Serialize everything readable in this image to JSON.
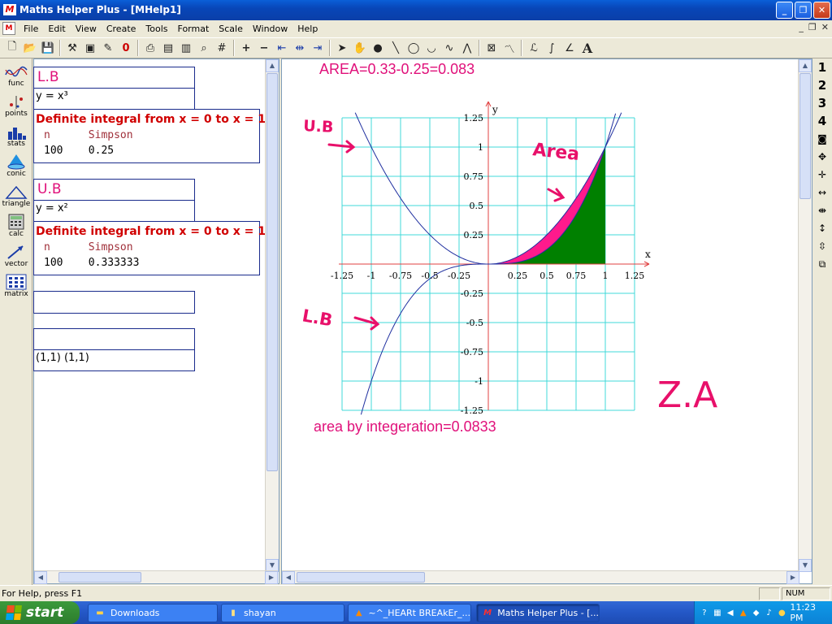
{
  "window": {
    "title": "Maths Helper Plus - [MHelp1]",
    "app_icon": "M",
    "buttons": [
      "minimize",
      "restore",
      "close"
    ]
  },
  "menu": {
    "items": [
      "File",
      "Edit",
      "View",
      "Create",
      "Tools",
      "Format",
      "Scale",
      "Window",
      "Help"
    ]
  },
  "toolbar": {
    "icons": [
      "new-icon",
      "open-icon",
      "save-icon",
      "tools-icon",
      "picture-icon",
      "pen-icon",
      "eraser-icon",
      "print-icon",
      "print-preview-icon",
      "print-setup-icon",
      "find-icon",
      "grid-icon",
      "zoom-in-icon",
      "zoom-out-icon",
      "fit-left-icon",
      "fit-center-icon",
      "fit-right-icon",
      "select-arrow-icon",
      "hand-icon",
      "point-icon",
      "line-icon",
      "ellipse-icon",
      "curve-icon",
      "wave-icon",
      "peak-icon",
      "clear-icon",
      "sketch-icon",
      "text-style-icon",
      "integral-icon",
      "angle-icon",
      "text-icon"
    ],
    "text_label": "A"
  },
  "left_toolbar": {
    "items": [
      {
        "label": "func",
        "icon": "function-icon"
      },
      {
        "label": "points",
        "icon": "points-icon"
      },
      {
        "label": "stats",
        "icon": "stats-icon"
      },
      {
        "label": "conic",
        "icon": "conic-icon"
      },
      {
        "label": "triangle",
        "icon": "triangle-icon"
      },
      {
        "label": "calc",
        "icon": "calculator-icon"
      },
      {
        "label": "vector",
        "icon": "vector-icon"
      },
      {
        "label": "matrix",
        "icon": "matrix-icon"
      }
    ]
  },
  "left_panel": {
    "lb_header": "L.B",
    "lb_formula": "y = x³",
    "lb_integral": {
      "title": "Definite integral from x = 0 to x = 1",
      "col_n": "n",
      "col_method": "Simpson",
      "n": "100",
      "value": "0.25"
    },
    "ub_header": "U.B",
    "ub_formula": "y = x²",
    "ub_integral": {
      "title": "Definite integral from x = 0 to x = 1",
      "col_n": "n",
      "col_method": "Simpson",
      "n": "100",
      "value": "0.333333"
    },
    "points_text": "(1,1) (1,1)"
  },
  "graph": {
    "area_text": "AREA=0.33-0.25=0.083",
    "integration_text": "area by integeration=0.0833",
    "x_axis_label": "x",
    "y_axis_label": "y",
    "x_ticks": [
      "-1.25",
      "-1",
      "-0.75",
      "-0.5",
      "-0.25",
      "0.25",
      "0.5",
      "0.75",
      "1",
      "1.25"
    ],
    "y_ticks": [
      "1.25",
      "1",
      "0.75",
      "0.5",
      "0.25",
      "-0.25",
      "-0.5",
      "-0.75",
      "-1",
      "-1.25"
    ],
    "annotations": {
      "ub": "U.B",
      "lb": "L.B",
      "area": "Area",
      "signature": "Z.A"
    },
    "colors": {
      "grid": "#40d8d8",
      "axis": "#e04040",
      "curve": "#2030a0",
      "area_fill": "#ff1a8c",
      "lower_fill": "#008000",
      "text": "#e0107a",
      "annotation": "#e8106a"
    }
  },
  "right_toolbar": {
    "numbers": [
      "1",
      "2",
      "3",
      "4"
    ],
    "icons": [
      "camera-icon",
      "move-icon",
      "move-small-icon",
      "stretch-h-icon",
      "shrink-h-icon",
      "stretch-v-icon",
      "shrink-v-icon",
      "copy-icon"
    ]
  },
  "status_bar": {
    "help_text": "For Help, press F1",
    "num_indicator": "NUM"
  },
  "taskbar": {
    "start_label": "start",
    "tasks": [
      {
        "label": "Downloads",
        "icon": "folder-icon"
      },
      {
        "label": "shayan",
        "icon": "file-icon"
      },
      {
        "label": "~^_HEARt BREAkEr_...",
        "icon": "vlc-icon"
      },
      {
        "label": "Maths Helper Plus - [...",
        "icon": "maths-helper-icon",
        "active": true
      }
    ],
    "clock": "11:23 PM"
  }
}
